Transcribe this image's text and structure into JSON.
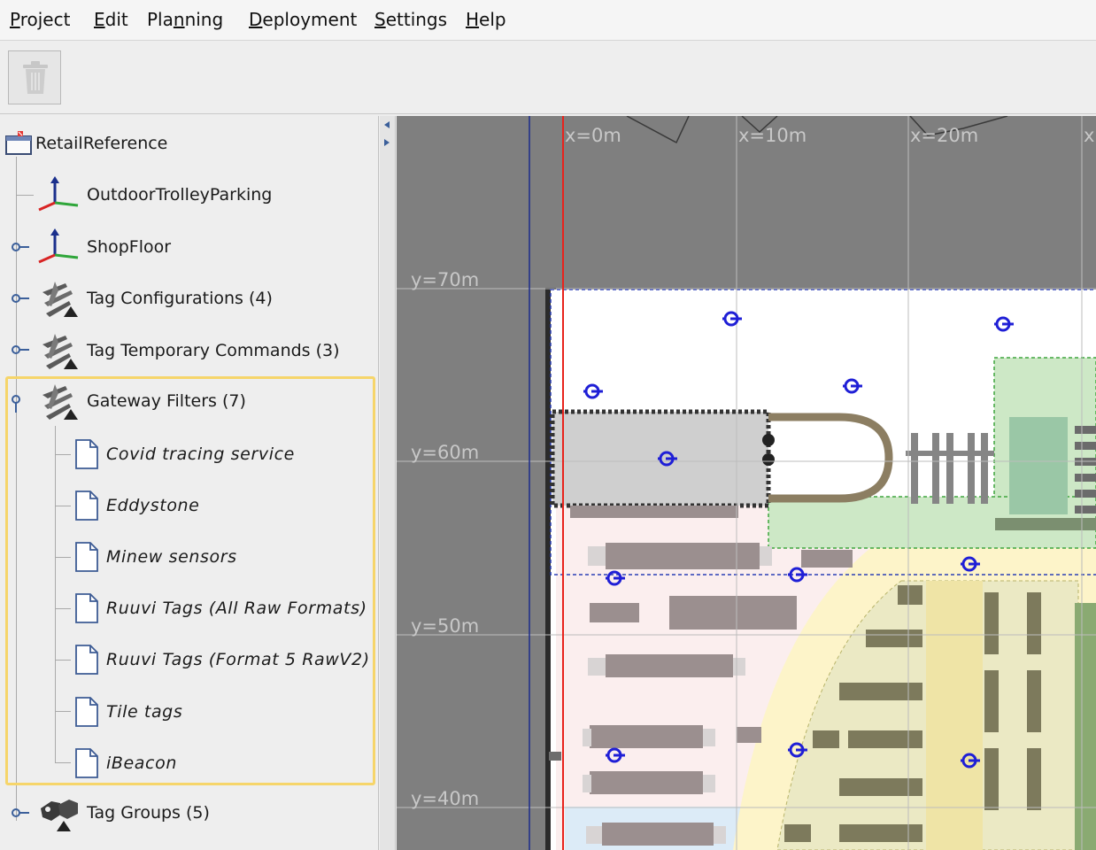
{
  "menubar": {
    "items": [
      {
        "label": "Project"
      },
      {
        "label": "Edit"
      },
      {
        "label": "Planning"
      },
      {
        "label": "Deployment"
      },
      {
        "label": "Settings"
      },
      {
        "label": "Help"
      }
    ]
  },
  "toolbar": {
    "delete_icon": "trash-icon"
  },
  "tree": {
    "root": {
      "label": "RetailReference",
      "icon": "project-icon"
    },
    "nodes": [
      {
        "label": "OutdoorTrolleyParking",
        "icon": "axes-icon"
      },
      {
        "label": "ShopFloor",
        "icon": "axes-icon"
      },
      {
        "label": "Tag Configurations (4)",
        "icon": "tools-icon"
      },
      {
        "label": "Tag Temporary Commands (3)",
        "icon": "tools-icon"
      },
      {
        "label": "Gateway Filters (7)",
        "icon": "tools-icon"
      },
      {
        "label": "Tag Groups (5)",
        "icon": "tag-group-icon"
      }
    ],
    "gateway_filters": [
      {
        "label": "Covid tracing service",
        "icon": "document-icon"
      },
      {
        "label": "Eddystone",
        "icon": "document-icon"
      },
      {
        "label": "Minew sensors",
        "icon": "document-icon"
      },
      {
        "label": "Ruuvi Tags (All Raw Formats)",
        "icon": "document-icon"
      },
      {
        "label": "Ruuvi Tags (Format 5 RawV2)",
        "icon": "document-icon"
      },
      {
        "label": "Tile tags",
        "icon": "document-icon"
      },
      {
        "label": "iBeacon",
        "icon": "document-icon"
      }
    ],
    "highlight_color": "#f6d56a"
  },
  "map": {
    "x_labels": [
      "x=0m",
      "x=10m",
      "x=20m",
      "x"
    ],
    "y_labels": [
      "y=70m",
      "y=60m",
      "y=50m",
      "y=40m"
    ],
    "colors": {
      "background": "#7f7f7f",
      "grid": "#b5b5b5",
      "origin_line": "#e8231c",
      "gateway": "#1f1fd6",
      "floor": "#ffffff",
      "zone_green": "#cfe8c8",
      "zone_yellow": "#f5f1c8"
    },
    "gateway_icon": "gateway-icon"
  }
}
